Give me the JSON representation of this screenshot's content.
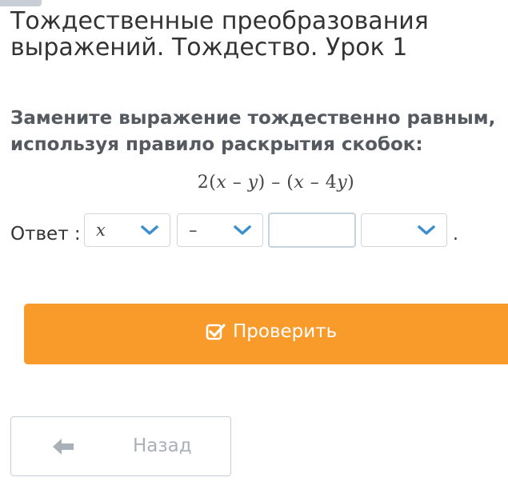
{
  "lesson": {
    "title": "Тождественные преобразования выражений. Тождество. Урок 1"
  },
  "task": {
    "question": "Замените выражение тождественно равным, используя правило раскрытия скобок:",
    "expression": {
      "p1": "2(",
      "v1": "x",
      "p2": " – ",
      "v2": "y",
      "p3": ") – (",
      "v3": "x",
      "p4": " – 4",
      "v4": "y",
      "p5": ")"
    }
  },
  "answer": {
    "label": "Ответ :",
    "select1_value": "x",
    "select2_value": "–",
    "input_value": "",
    "select3_value": "",
    "end_mark": "."
  },
  "buttons": {
    "check_label": "Проверить",
    "back_label": "Назад"
  },
  "colors": {
    "accent": "#f99b2b",
    "chevron": "#3a8fd0",
    "back_arrow": "#a9b0b8"
  },
  "icons": {
    "check": "checkbox-check-icon",
    "chevron": "chevron-down-icon",
    "back": "arrow-left-icon"
  }
}
